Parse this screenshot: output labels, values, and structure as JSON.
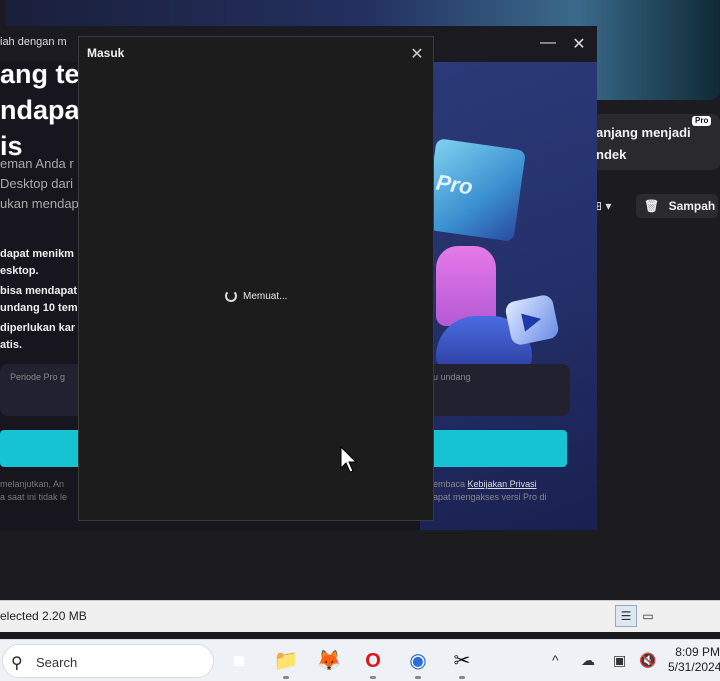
{
  "background_app": {
    "card_text": "anjang menjadi ndek",
    "pro_tag": "Pro",
    "trash_label": "Sampah",
    "view_toggle": "⊞ ▾"
  },
  "pro_window": {
    "topline": "iah dengan m",
    "heading_lines": [
      "ang te",
      "ndapat",
      "is"
    ],
    "sub_lines": [
      "eman Anda r",
      "Desktop dari",
      "ukan mendap"
    ],
    "bullets": [
      "dapat menikm",
      "esktop.",
      "bisa mendapat",
      "undang 10 tem",
      "diperlukan kar",
      "atis."
    ],
    "period_left": "Periode Pro g",
    "period_right": "u undang",
    "foot_left_lines": [
      "melanjutkan, An",
      "a saat ini tidak le"
    ],
    "foot_right_lines": [
      "embaca",
      "apat mengakses versi Pro di"
    ],
    "privacy_link": "Kebijakan Privasi",
    "minimize": "—",
    "close": "✕"
  },
  "dialog": {
    "title": "Masuk",
    "close": "✕",
    "loading": "Memuat..."
  },
  "statusbar": {
    "text": "elected  2.20 MB"
  },
  "taskbar": {
    "search_placeholder": "Search",
    "apps": [
      {
        "name": "task-view",
        "glyph": "■"
      },
      {
        "name": "file-explorer",
        "glyph": "📁"
      },
      {
        "name": "firefox",
        "glyph": "🦊"
      },
      {
        "name": "opera",
        "glyph": "O"
      },
      {
        "name": "chrome",
        "glyph": "◉"
      },
      {
        "name": "capcut",
        "glyph": "✂"
      }
    ],
    "time": "8:09 PM",
    "date": "5/31/2024"
  }
}
